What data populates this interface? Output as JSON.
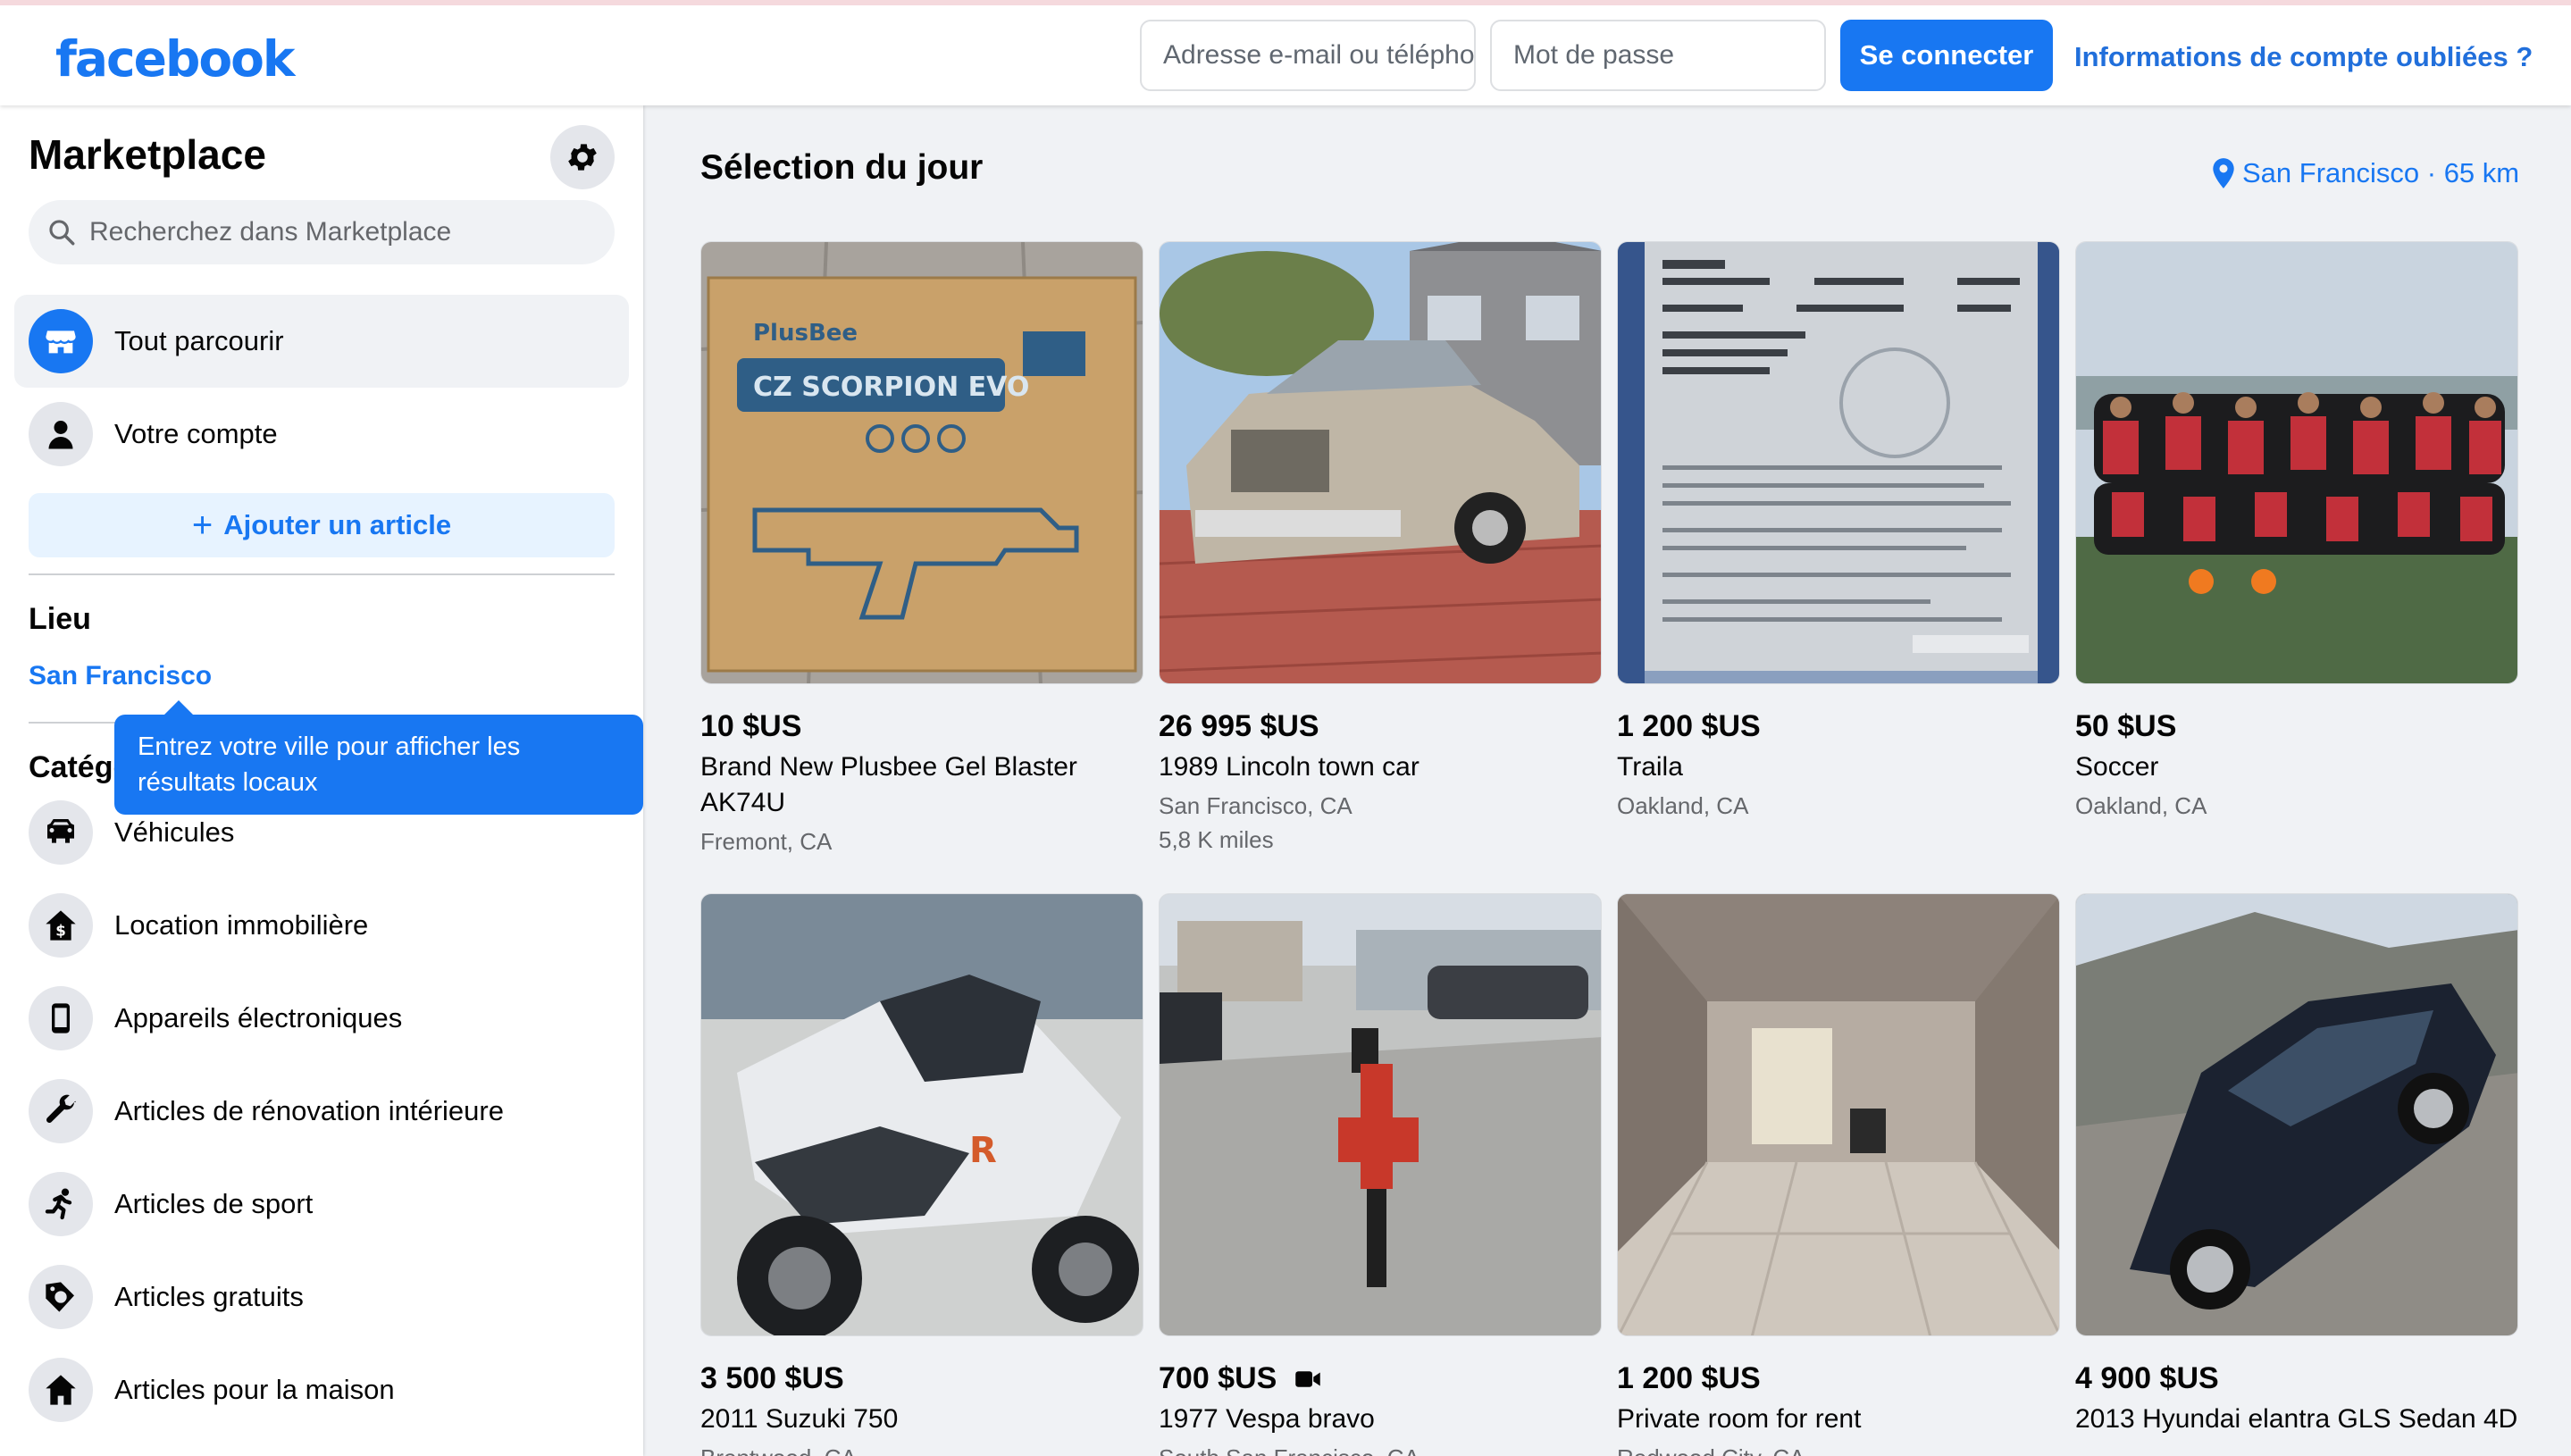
{
  "header": {
    "logo": "facebook",
    "email_placeholder": "Adresse e-mail ou téléphone",
    "password_placeholder": "Mot de passe",
    "login_label": "Se connecter",
    "forgot_label": "Informations de compte oubliées ?"
  },
  "sidebar": {
    "title": "Marketplace",
    "search_placeholder": "Recherchez dans Marketplace",
    "nav": [
      {
        "label": "Tout parcourir",
        "icon": "shop-icon",
        "active": true
      },
      {
        "label": "Votre compte",
        "icon": "person-icon",
        "active": false
      }
    ],
    "add_label": "Ajouter un article",
    "location_heading": "Lieu",
    "location_value": "San Francisco",
    "tooltip": "Entrez votre ville pour afficher les résultats locaux",
    "categories_heading": "Catégories",
    "categories": [
      {
        "label": "Véhicules",
        "icon": "car-icon"
      },
      {
        "label": "Location immobilière",
        "icon": "house-dollar-icon"
      },
      {
        "label": "Appareils électroniques",
        "icon": "phone-icon"
      },
      {
        "label": "Articles de rénovation intérieure",
        "icon": "wrench-icon"
      },
      {
        "label": "Articles de sport",
        "icon": "running-icon"
      },
      {
        "label": "Articles gratuits",
        "icon": "free-tag-icon"
      },
      {
        "label": "Articles pour la maison",
        "icon": "home-icon"
      }
    ]
  },
  "main": {
    "title": "Sélection du jour",
    "location": "San Francisco · 65 km",
    "listings": [
      {
        "price": "10 $US",
        "title": "Brand New Plusbee Gel Blaster AK74U",
        "location": "Fremont, CA"
      },
      {
        "price": "26 995 $US",
        "title": "1989 Lincoln town car",
        "location": "San Francisco, CA",
        "meta": "5,8 K miles"
      },
      {
        "price": "1 200 $US",
        "title": "Traila",
        "location": "Oakland, CA"
      },
      {
        "price": "50 $US",
        "title": "Soccer",
        "location": "Oakland, CA"
      },
      {
        "price": "3 500 $US",
        "title": "2011 Suzuki 750",
        "location": "Brentwood, CA"
      },
      {
        "price": "700 $US",
        "title": "1977 Vespa bravo",
        "location": "South San Francisco, CA",
        "video": true
      },
      {
        "price": "1 200 $US",
        "title": "Private room for rent",
        "location": "Redwood City, CA"
      },
      {
        "price": "4 900 $US",
        "title": "2013 Hyundai elantra GLS Sedan 4D",
        "location": ""
      }
    ]
  },
  "colors": {
    "brand": "#1877f2",
    "link": "#216fdb",
    "background": "#f0f2f5"
  }
}
